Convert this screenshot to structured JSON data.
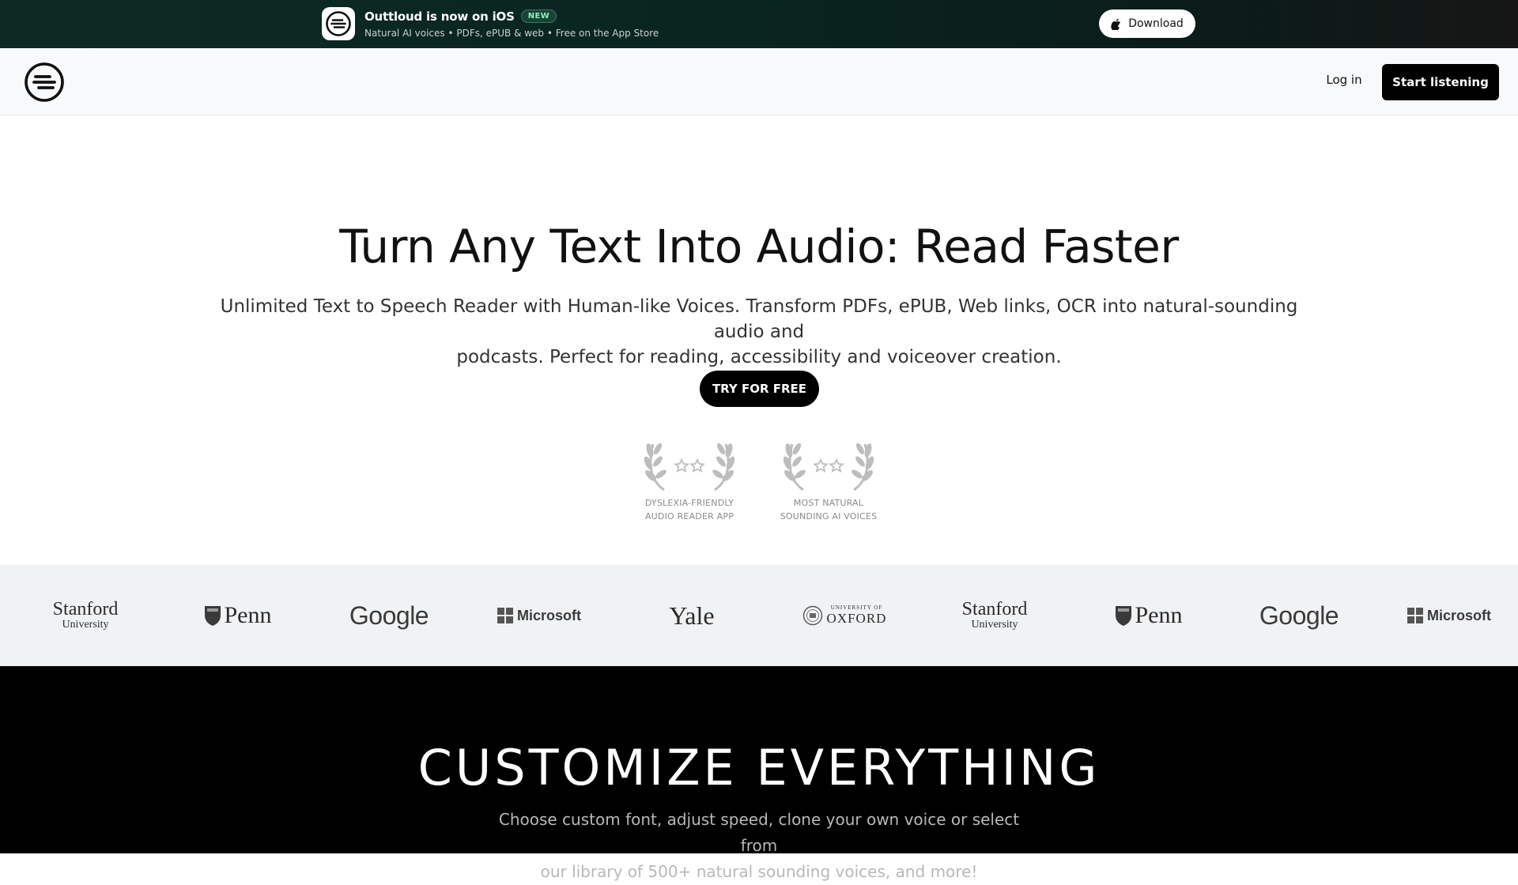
{
  "promo": {
    "title": "Outtloud is now on iOS",
    "badge": "NEW",
    "subtitle": "Natural AI voices • PDFs, ePUB & web • Free on the App Store",
    "download_label": "Download"
  },
  "nav": {
    "login_label": "Log in",
    "cta_label": "Start listening"
  },
  "hero": {
    "title": "Turn Any Text Into Audio: Read Faster",
    "subtitle_line1": "Unlimited Text to Speech Reader with Human-like Voices. Transform PDFs, ePUB, Web links, OCR into natural-sounding audio and",
    "subtitle_line2": "podcasts. Perfect for reading, accessibility and voiceover creation.",
    "cta_label": "TRY FOR FREE"
  },
  "awards": [
    {
      "line1": "DYSLEXIA-FRIENDLY",
      "line2": "AUDIO READER APP"
    },
    {
      "line1": "MOST NATURAL",
      "line2": "SOUNDING AI VOICES"
    }
  ],
  "logos": {
    "stanford_1": {
      "line1": "Stanford",
      "line2": "University"
    },
    "penn_1": "Penn",
    "google_1": "Google",
    "microsoft_1": "Microsoft",
    "yale": "Yale",
    "oxford": {
      "small": "UNIVERSITY OF",
      "big": "OXFORD"
    },
    "stanford_2": {
      "line1": "Stanford",
      "line2": "University"
    },
    "penn_2": "Penn",
    "google_2": "Google",
    "microsoft_2": "Microsoft"
  },
  "customize": {
    "title": "CUSTOMIZE EVERYTHING",
    "subtitle_line1": "Choose custom font, adjust speed, clone your own voice or select from",
    "subtitle_line2": "our library of 500+ natural sounding voices, and more!"
  },
  "colors": {
    "banner_bg": "#0c2a22",
    "cta_bg": "#000000",
    "logos_bg": "#f1f2f4",
    "badge_text": "#8ef0c2"
  }
}
